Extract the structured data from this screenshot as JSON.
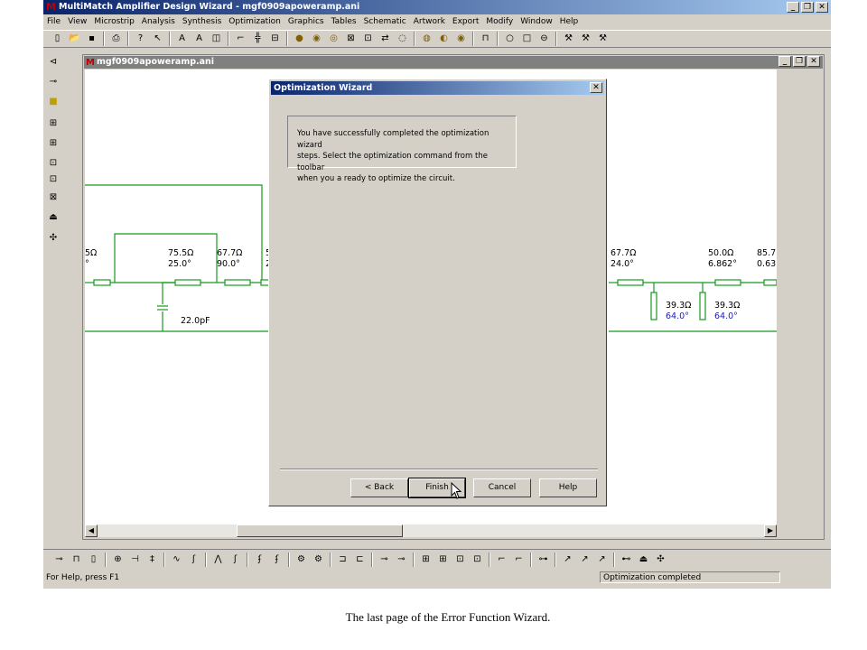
{
  "app": {
    "title": "MultiMatch Amplifier Design Wizard - mgf0909apoweramp.ani",
    "window_buttons": {
      "minimize": "_",
      "restore": "❐",
      "close": "✕"
    }
  },
  "menu": [
    "File",
    "View",
    "Microstrip",
    "Analysis",
    "Synthesis",
    "Optimization",
    "Graphics",
    "Tables",
    "Schematic",
    "Artwork",
    "Export",
    "Modify",
    "Window",
    "Help"
  ],
  "child_window": {
    "title": "mgf0909apoweramp.ani"
  },
  "schematic": {
    "left_labels": [
      {
        "l1": "5Ω",
        "l2": "°"
      },
      {
        "l1": "75.5Ω",
        "l2": "25.0°"
      },
      {
        "l1": "67.7Ω",
        "l2": "90.0°"
      },
      {
        "l1": "5",
        "l2": "2"
      }
    ],
    "cap_label": "22.0pF",
    "right_labels": [
      {
        "l1": "67.7Ω",
        "l2": "24.0°"
      },
      {
        "l1": "50.0Ω",
        "l2": "6.862°"
      },
      {
        "l1": "85.7",
        "l2": "0.63"
      }
    ],
    "stubs": [
      {
        "l1": "39.3Ω",
        "l2": "64.0°"
      },
      {
        "l1": "39.3Ω",
        "l2": "64.0°"
      }
    ],
    "colors": {
      "wire": "#169b1d",
      "stub_text": "#1a1ab8"
    }
  },
  "dialog": {
    "title": "Optimization Wizard",
    "message": [
      "You have successfully completed the optimization wizard",
      "steps. Select the optimization command from the toolbar",
      "when you a ready to optimize the circuit."
    ],
    "buttons": {
      "back": "< Back",
      "finish": "Finish",
      "cancel": "Cancel",
      "help": "Help"
    }
  },
  "status": {
    "left": "For Help, press F1",
    "right": "Optimization completed"
  },
  "caption": "The last page of the Error Function Wizard."
}
